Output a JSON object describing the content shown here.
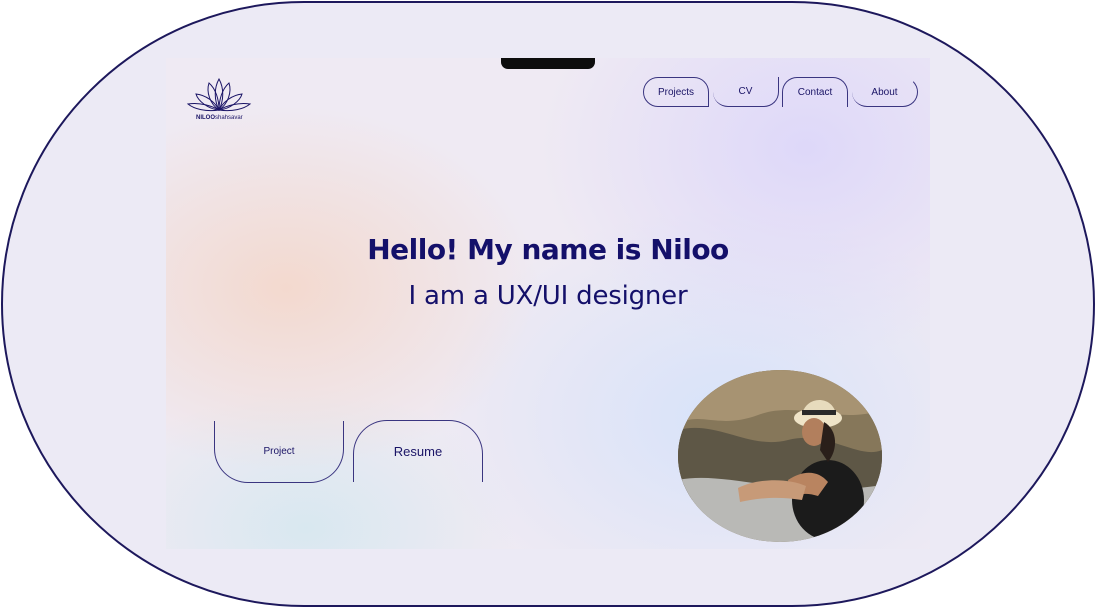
{
  "logo": {
    "name_bold": "NILOO",
    "name_light": "shahsavar"
  },
  "nav": {
    "items": [
      {
        "label": "Projects"
      },
      {
        "label": "CV"
      },
      {
        "label": "Contact"
      },
      {
        "label": "About"
      }
    ]
  },
  "hero": {
    "headline": "Hello! My name is Niloo",
    "subheadline": "I am a UX/UI designer"
  },
  "cta": {
    "project_label": "Project",
    "resume_label": "Resume"
  },
  "colors": {
    "text": "#14106a",
    "frame": "#1d185c",
    "outline": "#3a3580"
  }
}
